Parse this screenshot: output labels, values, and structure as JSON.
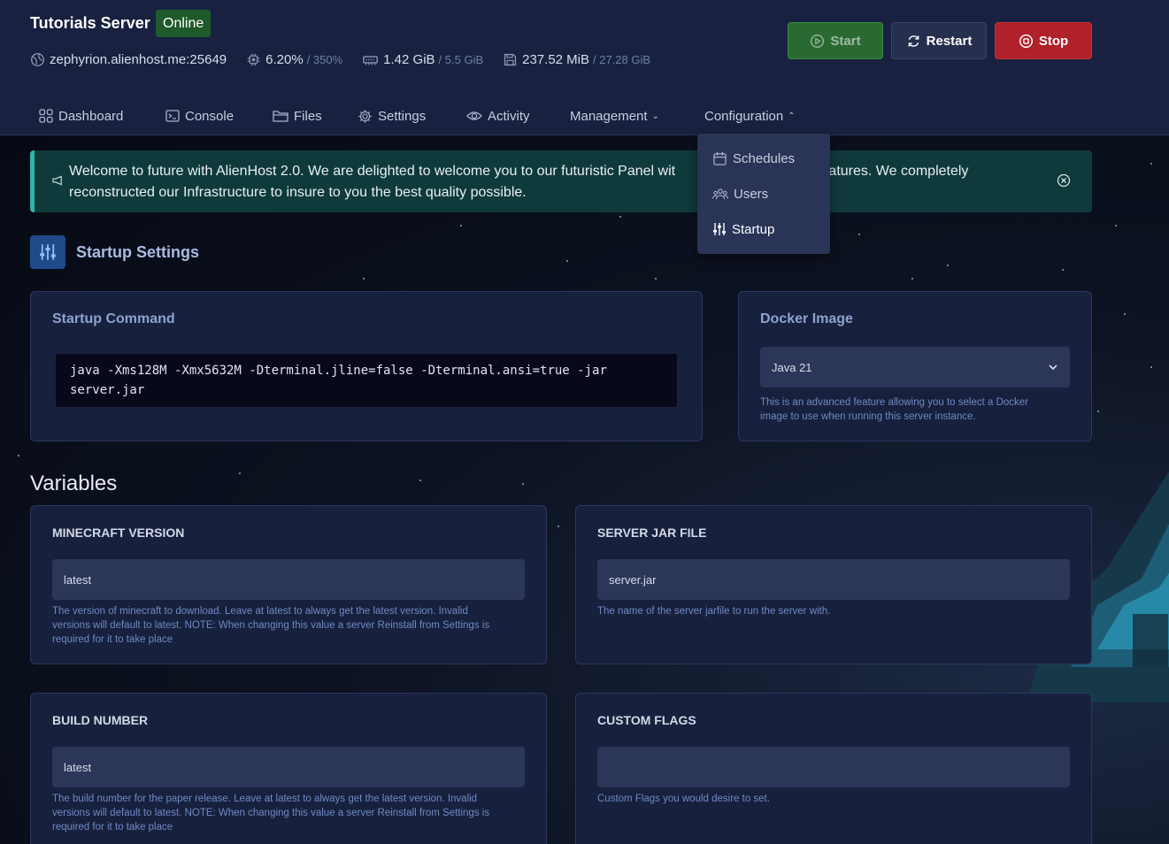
{
  "server": {
    "title": "Tutorials Server",
    "status": "Online",
    "address": "zephyrion.alienhost.me:25649",
    "cpu": "6.20%",
    "cpu_max": "/ 350%",
    "memory": "1.42 GiB",
    "memory_max": "/ 5.5 GiB",
    "disk": "237.52 MiB",
    "disk_max": "/ 27.28 GiB"
  },
  "power": {
    "start": "Start",
    "restart": "Restart",
    "stop": "Stop"
  },
  "nav": {
    "dashboard": "Dashboard",
    "console": "Console",
    "files": "Files",
    "settings": "Settings",
    "activity": "Activity",
    "management": "Management",
    "configuration": "Configuration"
  },
  "dropdown": {
    "schedules": "Schedules",
    "users": "Users",
    "startup": "Startup"
  },
  "alert": {
    "line1_a": "Welcome to future with AlienHost 2.0. We are delighted to welcome you to our futuristic Panel wit",
    "line1_b": "features. We completely",
    "line2": "reconstructed our Infrastructure to insure to you the best quality possible."
  },
  "page": {
    "title": "Startup Settings"
  },
  "startup_command": {
    "title": "Startup Command",
    "line1": "java -Xms128M -Xmx5632M -Dterminal.jline=false -Dterminal.ansi=true -jar",
    "line2": "server.jar"
  },
  "docker": {
    "title": "Docker Image",
    "selected": "Java 21",
    "hint_line1": "This is an advanced feature allowing you to select a Docker",
    "hint_line2": "image to use when running this server instance."
  },
  "variables": {
    "heading": "Variables",
    "minecraft_version": {
      "label": "MINECRAFT VERSION",
      "value": "latest",
      "hint_line1": "The version of minecraft to download. Leave at latest to always get the latest version. Invalid",
      "hint_line2": "versions will default to latest. NOTE: When changing this value a server Reinstall from Settings is",
      "hint_line3": "required for it to take place"
    },
    "server_jar": {
      "label": "SERVER JAR FILE",
      "value": "server.jar",
      "hint_line1": "The name of the server jarfile to run the server with."
    },
    "build_number": {
      "label": "BUILD NUMBER",
      "value": "latest",
      "hint_line1": "The build number for the paper release. Leave at latest to always get the latest version. Invalid",
      "hint_line2": "versions will default to latest. NOTE: When changing this value a server Reinstall from Settings is",
      "hint_line3": "required for it to take place"
    },
    "custom_flags": {
      "label": "CUSTOM FLAGS",
      "value": "",
      "hint_line1": "Custom Flags you would desire to set."
    }
  },
  "colors": {
    "header_bg": "#18213f",
    "start_green": "#2a6a32",
    "stop_red": "#b0212a",
    "alert_teal": "#0f3a3c",
    "card_bg": "#17203d"
  }
}
